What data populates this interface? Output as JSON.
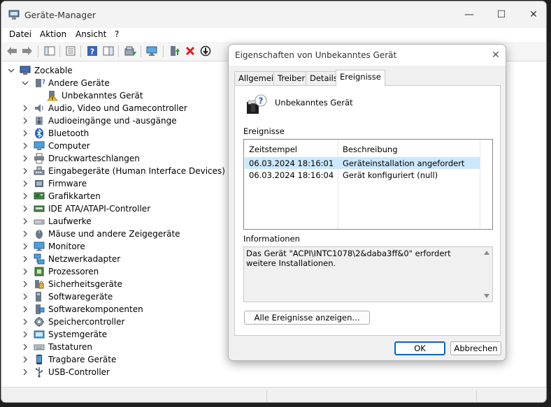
{
  "main_window": {
    "title": "Geräte-Manager",
    "controls": {
      "minimize": "—",
      "maximize": "☐",
      "close": "✕"
    }
  },
  "menu": [
    "Datei",
    "Aktion",
    "Ansicht",
    "?"
  ],
  "tree": {
    "root": "Zockable",
    "items": [
      {
        "label": "Andere Geräte",
        "expanded": true,
        "icon": "other-devices-icon"
      },
      {
        "label": "Unbekanntes Gerät",
        "child": true,
        "icon": "unknown-device-warning-icon"
      },
      {
        "label": "Audio, Video und Gamecontroller",
        "icon": "audio-icon"
      },
      {
        "label": "Audioeingänge und -ausgänge",
        "icon": "speaker-icon"
      },
      {
        "label": "Bluetooth",
        "icon": "bluetooth-icon"
      },
      {
        "label": "Computer",
        "icon": "computer-icon"
      },
      {
        "label": "Druckwarteschlangen",
        "icon": "printer-icon"
      },
      {
        "label": "Eingabegeräte (Human Interface Devices)",
        "icon": "hid-icon"
      },
      {
        "label": "Firmware",
        "icon": "firmware-icon"
      },
      {
        "label": "Grafikkarten",
        "icon": "display-adapter-icon"
      },
      {
        "label": "IDE ATA/ATAPI-Controller",
        "icon": "ide-controller-icon"
      },
      {
        "label": "Laufwerke",
        "icon": "disk-drive-icon"
      },
      {
        "label": "Mäuse und andere Zeigegeräte",
        "icon": "mouse-icon"
      },
      {
        "label": "Monitore",
        "icon": "monitor-icon"
      },
      {
        "label": "Netzwerkadapter",
        "icon": "network-adapter-icon"
      },
      {
        "label": "Prozessoren",
        "icon": "processor-icon"
      },
      {
        "label": "Sicherheitsgeräte",
        "icon": "security-device-icon"
      },
      {
        "label": "Softwaregeräte",
        "icon": "software-device-icon"
      },
      {
        "label": "Softwarekomponenten",
        "icon": "software-component-icon"
      },
      {
        "label": "Speichercontroller",
        "icon": "storage-controller-icon"
      },
      {
        "label": "Systemgeräte",
        "icon": "system-device-icon"
      },
      {
        "label": "Tastaturen",
        "icon": "keyboard-icon"
      },
      {
        "label": "Tragbare Geräte",
        "icon": "portable-device-icon"
      },
      {
        "label": "USB-Controller",
        "icon": "usb-icon"
      }
    ]
  },
  "dialog": {
    "title": "Eigenschaften von Unbekanntes Gerät",
    "tabs": [
      "Allgemein",
      "Treiber",
      "Details",
      "Ereignisse"
    ],
    "active_tab": "Ereignisse",
    "device_name": "Unbekanntes Gerät",
    "events_label": "Ereignisse",
    "columns": [
      "Zeitstempel",
      "Beschreibung"
    ],
    "events": [
      {
        "time": "06.03.2024 18:16:01",
        "desc": "Geräteinstallation angefordert",
        "selected": true
      },
      {
        "time": "06.03.2024 18:16:04",
        "desc": "Gerät konfiguriert (null)",
        "selected": false
      }
    ],
    "info_label": "Informationen",
    "info_text": "Das Gerät \"ACPI\\INTC1078\\2&daba3ff&0\" erfordert weitere Installationen.",
    "show_all_button": "Alle Ereignisse anzeigen...",
    "ok_button": "OK",
    "cancel_button": "Abbrechen"
  },
  "colors": {
    "selection": "#cce8ff",
    "accent": "#0067c0",
    "error_red": "#d81e1e",
    "window_bg": "#f0f0f0"
  }
}
